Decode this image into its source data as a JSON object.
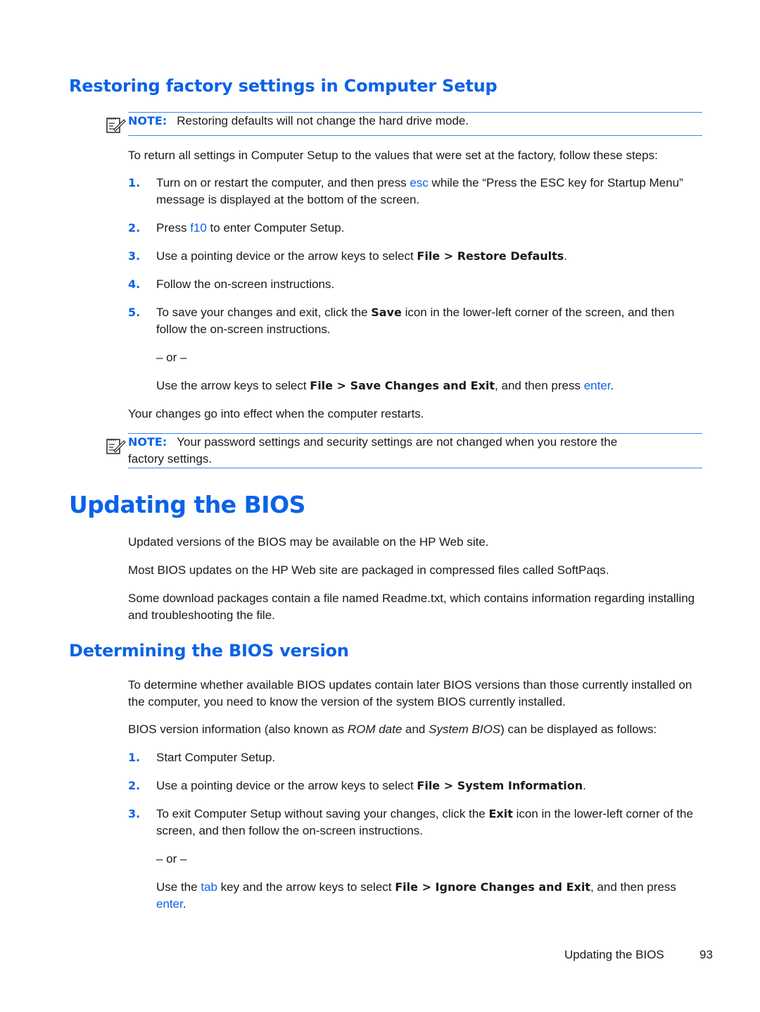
{
  "section1": {
    "heading": "Restoring factory settings in Computer Setup",
    "note1": {
      "label": "NOTE:",
      "text": "Restoring defaults will not change the hard drive mode.",
      "icon": "note-icon"
    },
    "intro": "To return all settings in Computer Setup to the values that were set at the factory, follow these steps:",
    "steps": [
      {
        "num": "1.",
        "pre": "Turn on or restart the computer, and then press ",
        "key": "esc",
        "post": " while the “Press the ESC key for Startup Menu” message is displayed at the bottom of the screen."
      },
      {
        "num": "2.",
        "pre": "Press ",
        "key": "f10",
        "post": " to enter Computer Setup."
      },
      {
        "num": "3.",
        "pre": "Use a pointing device or the arrow keys to select ",
        "bold": "File > Restore Defaults",
        "post": "."
      },
      {
        "num": "4.",
        "text": "Follow the on-screen instructions."
      },
      {
        "num": "5.",
        "pre": "To save your changes and exit, click the ",
        "bold": "Save",
        "post": " icon in the lower-left corner of the screen, and then follow the on-screen instructions."
      }
    ],
    "or": "– or –",
    "alt": {
      "pre": "Use the arrow keys to select ",
      "bold": "File > Save Changes and Exit",
      "mid": ", and then press ",
      "key": "enter",
      "post": "."
    },
    "outro": "Your changes go into effect when the computer restarts.",
    "note2": {
      "label": "NOTE:",
      "text": "Your password settings and security settings are not changed when you restore the factory settings.",
      "icon": "note-icon"
    }
  },
  "section2": {
    "heading": "Updating the BIOS",
    "paras": [
      "Updated versions of the BIOS may be available on the HP Web site.",
      "Most BIOS updates on the HP Web site are packaged in compressed files called SoftPaqs.",
      "Some download packages contain a file named Readme.txt, which contains information regarding installing and troubleshooting the file."
    ]
  },
  "section3": {
    "heading": "Determining the BIOS version",
    "para1": "To determine whether available BIOS updates contain later BIOS versions than those currently installed on the computer, you need to know the version of the system BIOS currently installed.",
    "para2": {
      "pre": "BIOS version information (also known as ",
      "em1": "ROM date",
      "mid": " and ",
      "em2": "System BIOS",
      "post": ") can be displayed as follows:"
    },
    "steps": [
      {
        "num": "1.",
        "text": "Start Computer Setup."
      },
      {
        "num": "2.",
        "pre": "Use a pointing device or the arrow keys to select ",
        "bold": "File > System Information",
        "post": "."
      },
      {
        "num": "3.",
        "pre": "To exit Computer Setup without saving your changes, click the ",
        "bold": "Exit",
        "post": " icon in the lower-left corner of the screen, and then follow the on-screen instructions."
      }
    ],
    "or": "– or –",
    "alt": {
      "pre": "Use the ",
      "key1": "tab",
      "mid1": " key and the arrow keys to select ",
      "bold": "File > Ignore Changes and Exit",
      "mid2": ", and then press ",
      "key2": "enter",
      "post": "."
    }
  },
  "footer": {
    "title": "Updating the BIOS",
    "page": "93"
  },
  "colors": {
    "accent": "#0a63e6",
    "rule": "#3b86f0",
    "text": "#1a1a1a"
  }
}
